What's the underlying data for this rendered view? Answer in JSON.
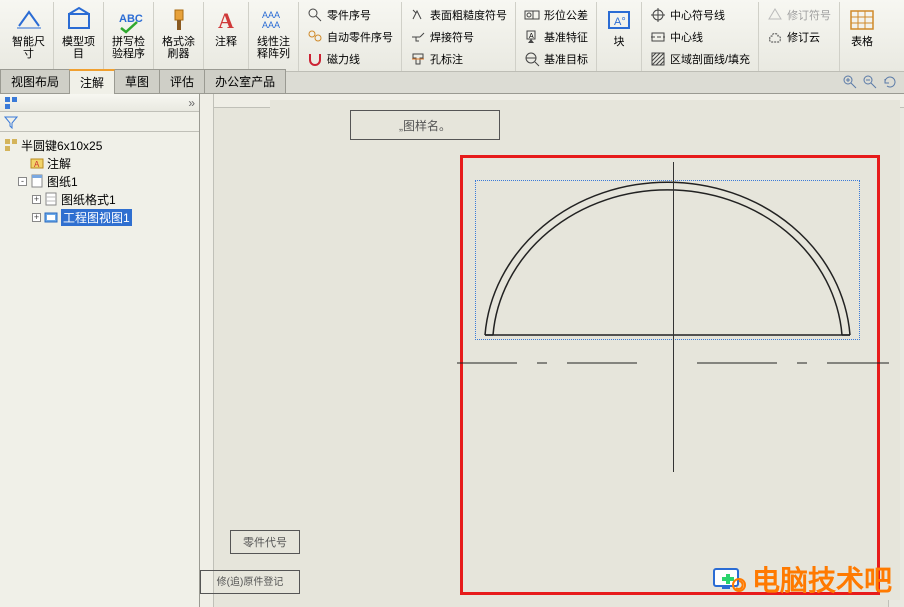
{
  "ribbon": {
    "big": [
      {
        "label": "智能尺\n寸"
      },
      {
        "label": "模型项\n目"
      },
      {
        "label": "拼写检\n验程序"
      },
      {
        "label": "格式涂\n刷器"
      },
      {
        "label": "注释"
      },
      {
        "label": "线性注\n释阵列"
      }
    ],
    "colA": [
      {
        "label": "零件序号"
      },
      {
        "label": "自动零件序号"
      },
      {
        "label": "磁力线"
      }
    ],
    "colB": [
      {
        "label": "表面粗糙度符号"
      },
      {
        "label": "焊接符号"
      },
      {
        "label": "孔标注"
      }
    ],
    "colC": [
      {
        "label": "形位公差"
      },
      {
        "label": "基准特征"
      },
      {
        "label": "基准目标"
      }
    ],
    "blockBtn": "块",
    "colD": [
      {
        "label": "中心符号线"
      },
      {
        "label": "中心线"
      },
      {
        "label": "区域剖面线/填充"
      }
    ],
    "colE": [
      {
        "label": "修订符号",
        "disabled": true
      },
      {
        "label": "修订云"
      }
    ],
    "tableBtn": "表格"
  },
  "tabs": [
    "视图布局",
    "注解",
    "草图",
    "评估",
    "办公室产品"
  ],
  "activeTab": 1,
  "tree": {
    "root": "半圆键6x10x25",
    "n1": "注解",
    "n2": "图纸1",
    "n3": "图纸格式1",
    "n4": "工程图视图1"
  },
  "drawing": {
    "title": "„图样名。",
    "partno": "零件代号",
    "rev": "修(追)原件登记"
  },
  "watermark": "电脑技术吧"
}
